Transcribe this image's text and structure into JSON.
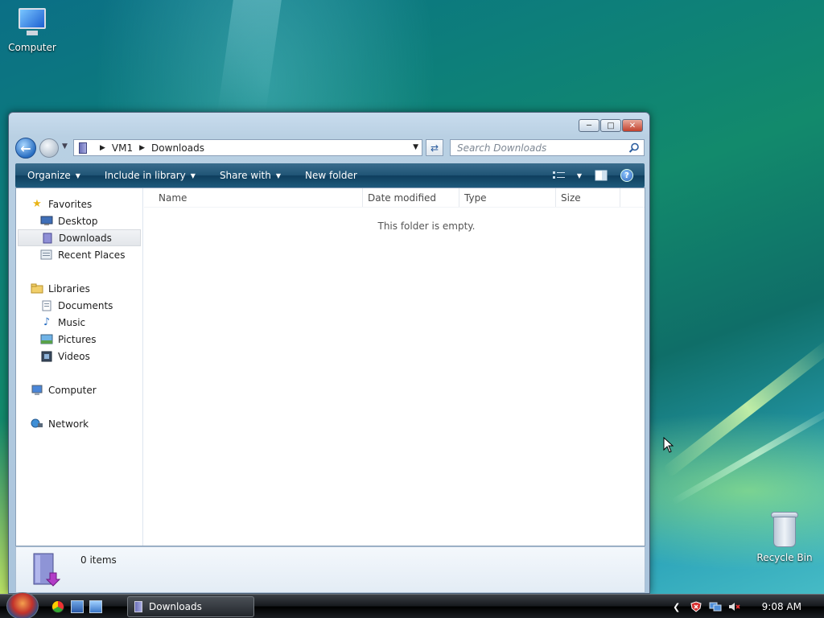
{
  "desktop": {
    "icons": [
      {
        "label": "Computer"
      },
      {
        "label": "Recycle Bin"
      }
    ]
  },
  "window": {
    "address": {
      "path": [
        "VM1",
        "Downloads"
      ]
    },
    "search": {
      "placeholder": "Search Downloads"
    },
    "toolbar": {
      "organize": "Organize",
      "include_in_library": "Include in library",
      "share_with": "Share with",
      "new_folder": "New folder"
    },
    "nav": {
      "favorites": "Favorites",
      "favorites_items": [
        "Desktop",
        "Downloads",
        "Recent Places"
      ],
      "libraries": "Libraries",
      "libraries_items": [
        "Documents",
        "Music",
        "Pictures",
        "Videos"
      ],
      "computer": "Computer",
      "network": "Network",
      "selected": "Downloads"
    },
    "columns": [
      "Name",
      "Date modified",
      "Type",
      "Size"
    ],
    "empty_message": "This folder is empty.",
    "details": {
      "item_count": "0 items"
    }
  },
  "taskbar": {
    "open_window": "Downloads",
    "clock": "9:08 AM"
  },
  "colors": {
    "toolbar": "#1f5475",
    "accent": "#2a6fc2"
  }
}
